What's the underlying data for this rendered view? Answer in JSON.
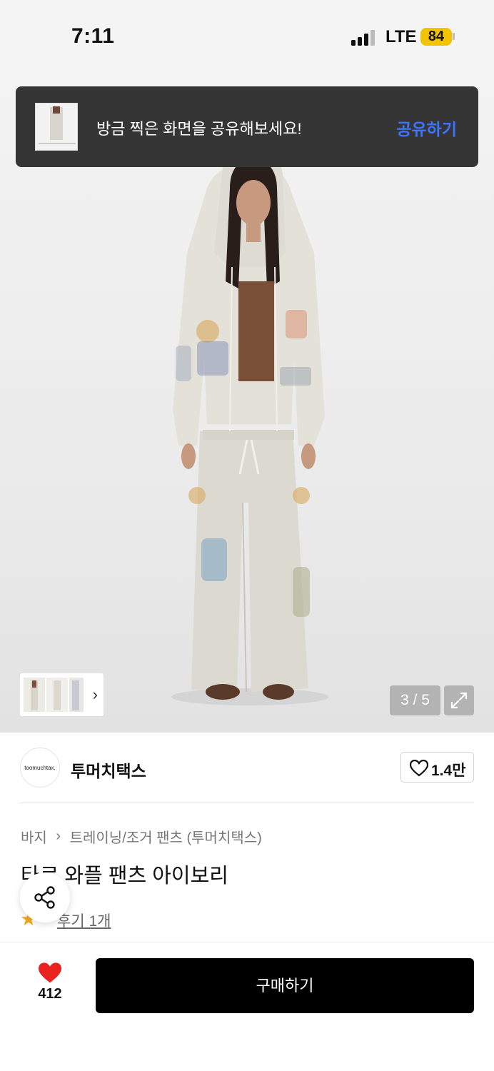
{
  "status_bar": {
    "time": "7:11",
    "network": "LTE",
    "battery": "84"
  },
  "share_banner": {
    "message": "방금 찍은 화면을 공유해보세요!",
    "action": "공유하기"
  },
  "gallery": {
    "counter": "3 / 5",
    "thumbnail_next_icon": "chevron-right-icon",
    "expand_icon": "expand-icon"
  },
  "brand": {
    "logo_text": "toomuchtax.",
    "name": "투머치택스",
    "likes": "1.4만"
  },
  "breadcrumb": {
    "items": [
      "바지",
      "트레이닝/조거 팬츠 (투머치택스)"
    ]
  },
  "product": {
    "title": "타로 와플 팬츠 아이보리",
    "rating": "5",
    "reviews": "후기 1개"
  },
  "bottom_bar": {
    "wish_count": "412",
    "buy_label": "구매하기"
  },
  "colors": {
    "accent": "#3c74ff",
    "heart": "#e8221f",
    "star": "#f4a71e",
    "buy": "#000000"
  }
}
